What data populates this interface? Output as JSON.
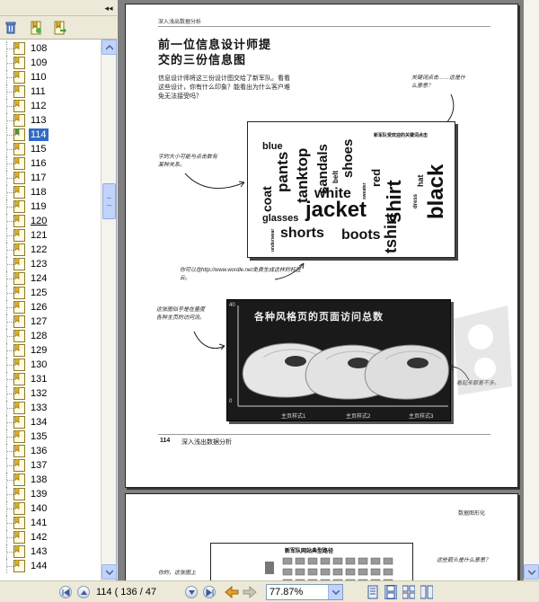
{
  "bookmarks": {
    "items": [
      "108",
      "109",
      "110",
      "111",
      "112",
      "113",
      "114",
      "115",
      "116",
      "117",
      "118",
      "119",
      "120",
      "121",
      "122",
      "123",
      "124",
      "125",
      "126",
      "127",
      "128",
      "129",
      "130",
      "131",
      "132",
      "133",
      "134",
      "135",
      "136",
      "137",
      "138",
      "139",
      "140",
      "141",
      "142",
      "143",
      "144"
    ],
    "selected": "114",
    "underlined": "120"
  },
  "page": {
    "header": "深入浅出数据分析",
    "title_line1": "前一位信息设计师提",
    "title_line2": "交的三份信息图",
    "body": "信息设计师将这三份设计图交给了新军队。看看这些设计，你有什么印象？能看出为什么客户难免无法接受吗？",
    "annotation_top_right": "关键词点击……这是什么意思？",
    "annotation_left_1": "字的大小可能与点击数有某种关系。",
    "annotation_bottom": "你可以在http://www.wordle.net免费生成这样的标签云。",
    "annotation_left_2": "这张图似乎是在量度各种主页的访问流。",
    "annotation_right_2": "看起来都差不多。",
    "cloud_caption": "新军队受欢迎的关键词点击",
    "cloud_words": [
      "blue",
      "pants",
      "tanktop",
      "sandals",
      "shoes",
      "belt",
      "coat",
      "white",
      "red",
      "hat",
      "black",
      "jacket",
      "shirt",
      "glasses",
      "underwear",
      "shorts",
      "boots",
      "tshirt",
      "dress",
      "sweater"
    ],
    "chart_title": "各种风格页的页面访问总数",
    "chart_y_top": "40",
    "chart_y_bottom": "0",
    "chart_x_labels": [
      "主页样式1",
      "主页样式2",
      "主页样式3"
    ],
    "footer_num": "114",
    "footer_title": "深入浅出数据分析",
    "next_header": "数据图形化",
    "next_caption": "新军队网站典型路径",
    "next_annot_left": "你的，这张图上",
    "next_annot_right": "这些箭头是什么意思？"
  },
  "nav": {
    "page_display": "114 ( 136 / 47",
    "zoom": "77.87%"
  }
}
